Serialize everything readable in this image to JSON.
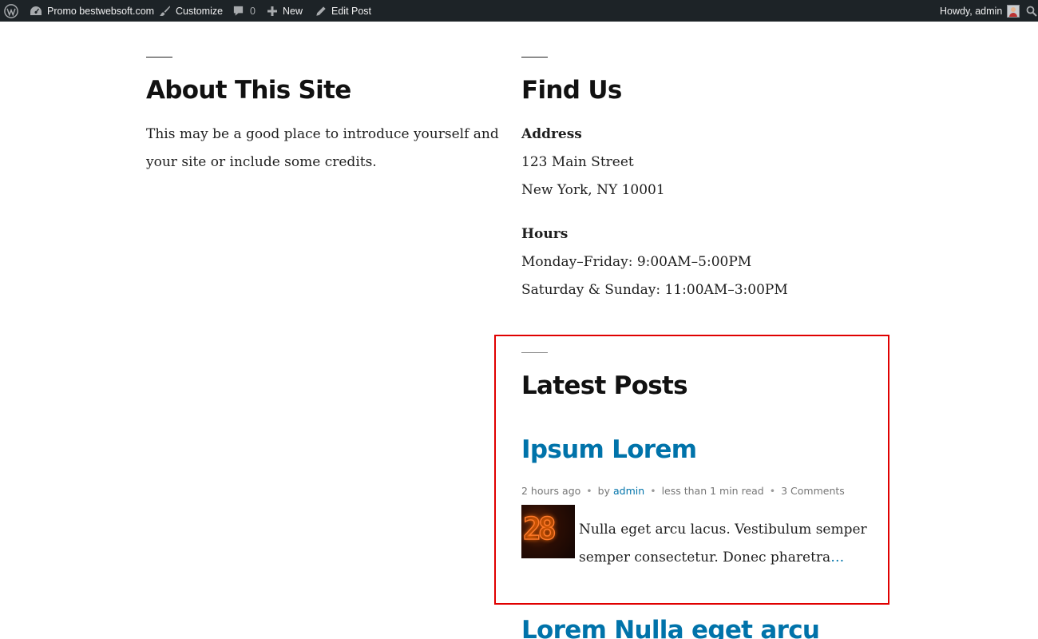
{
  "admin_bar": {
    "site_name": "Promo bestwebsoft.com",
    "customize": "Customize",
    "comments_count": "0",
    "new": "New",
    "edit_post": "Edit Post",
    "howdy": "Howdy, admin"
  },
  "about": {
    "title": "About This Site",
    "line1": "This may be a good place to introduce yourself and",
    "line2": "your site or include some credits."
  },
  "find_us": {
    "title": "Find Us",
    "address_label": "Address",
    "address_line1": "123 Main Street",
    "address_line2": "New York, NY 10001",
    "hours_label": "Hours",
    "hours_line1": "Monday–Friday: 9:00AM–5:00PM",
    "hours_line2": "Saturday & Sunday: 11:00AM–3:00PM"
  },
  "latest_posts": {
    "title": "Latest Posts",
    "posts": [
      {
        "title": "Ipsum Lorem",
        "time": "2 hours ago",
        "by": "by",
        "author": "admin",
        "read_time": "less than 1 min read",
        "comments": "3 Comments",
        "thumb_digits": "28",
        "excerpt_line1": "Nulla eget arcu lacus. Vestibulum semper",
        "excerpt_line2": "semper consectetur. Donec pharetra",
        "more": "…"
      },
      {
        "title": "Lorem Nulla eget arcu"
      }
    ]
  },
  "colors": {
    "admin_bar_bg": "#1d2327",
    "link": "#0073aa",
    "highlight_border": "#e00000"
  }
}
